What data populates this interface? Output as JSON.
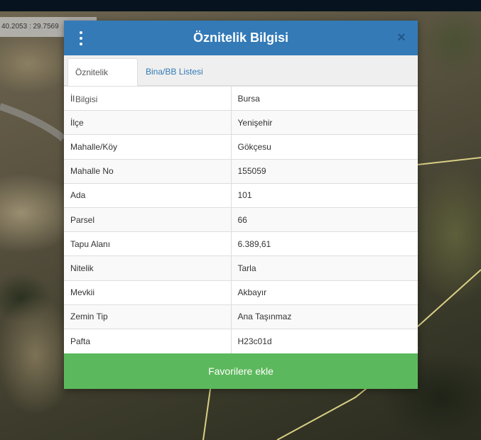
{
  "map": {
    "coordinates": "40.2053 : 29.7569"
  },
  "dialog": {
    "title": "Öznitelik Bilgisi",
    "close_symbol": "×",
    "menu_icon": "kebab-menu-icon",
    "tabs": [
      {
        "label": "Öznitelik Bilgisi",
        "active": true
      },
      {
        "label": "Bina/BB Listesi",
        "active": false
      }
    ],
    "rows": [
      {
        "key": "İl",
        "value": "Bursa"
      },
      {
        "key": "İlçe",
        "value": "Yenişehir"
      },
      {
        "key": "Mahalle/Köy",
        "value": "Gökçesu"
      },
      {
        "key": "Mahalle No",
        "value": "155059"
      },
      {
        "key": "Ada",
        "value": "101"
      },
      {
        "key": "Parsel",
        "value": "66"
      },
      {
        "key": "Tapu Alanı",
        "value": "6.389,61"
      },
      {
        "key": "Nitelik",
        "value": "Tarla"
      },
      {
        "key": "Mevkii",
        "value": "Akbayır"
      },
      {
        "key": "Zemin Tip",
        "value": "Ana Taşınmaz"
      },
      {
        "key": "Pafta",
        "value": "H23c01d"
      }
    ],
    "favorite_button": "Favorilere ekle"
  },
  "colors": {
    "header": "#337ab7",
    "tab_link": "#337ab7",
    "favorite_button": "#5cb85c",
    "parcel_line": "#d8cf84"
  }
}
